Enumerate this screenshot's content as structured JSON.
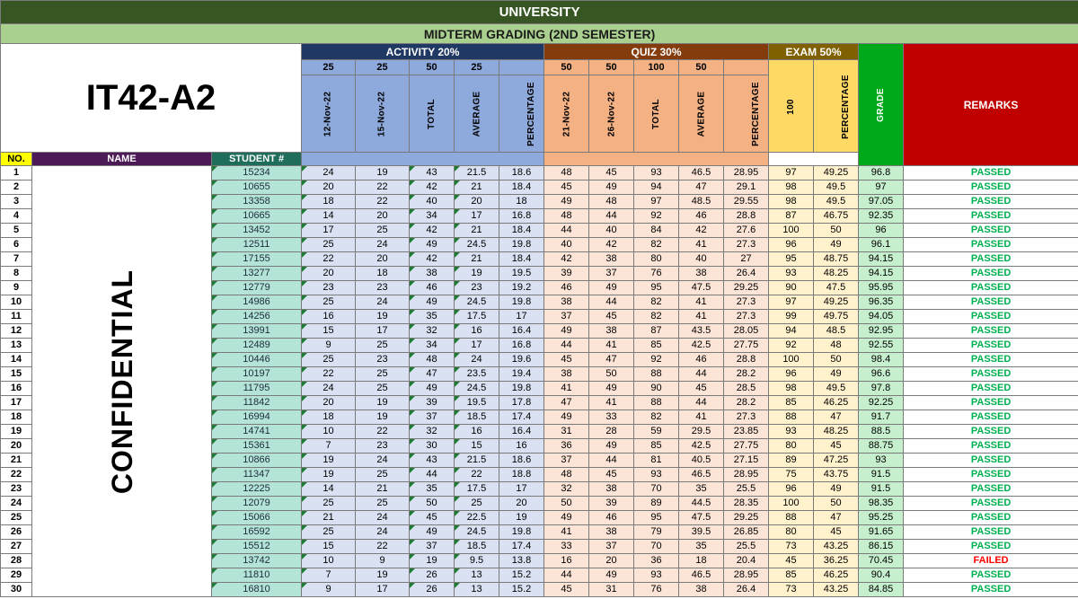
{
  "header": {
    "university": "UNIVERSITY",
    "term": "MIDTERM GRADING (2ND SEMESTER)",
    "section": "IT42-A2",
    "confidential": "CONFIDENTIAL"
  },
  "groups": {
    "activity": "ACTIVITY 20%",
    "quiz": "QUIZ 30%",
    "exam": "EXAM 50%",
    "grade": "GRADE",
    "remarks": "REMARKS"
  },
  "points": {
    "act1": "25",
    "act2": "25",
    "act_total": "50",
    "act_avg": "25",
    "quiz1": "50",
    "quiz2": "50",
    "quiz_total": "100",
    "quiz_avg": "50"
  },
  "sub_headers": {
    "act1": "12-Nov-22",
    "act2": "15-Nov-22",
    "act_total": "TOTAL",
    "act_avg": "AVERAGE",
    "act_pct": "PERCENTAGE",
    "quiz1": "21-Nov-22",
    "quiz2": "26-Nov-22",
    "quiz_total": "TOTAL",
    "quiz_avg": "AVERAGE",
    "quiz_pct": "PERCENTAGE",
    "exam": "100",
    "exam_pct": "PERCENTAGE"
  },
  "columns": {
    "no": "NO.",
    "name": "NAME",
    "student": "STUDENT #"
  },
  "colors": {
    "pass": "#00b050",
    "fail": "#ff0000",
    "university_bg": "#375623",
    "midterm_bg": "#a9d08e",
    "activity": "#203864",
    "quiz": "#843c0c",
    "exam": "#806000",
    "grade": "#00a91a",
    "remarks": "#c00000"
  },
  "rows": [
    {
      "no": "1",
      "sid": "15234",
      "a1": "24",
      "a2": "19",
      "at": "43",
      "aa": "21.5",
      "ap": "18.6",
      "q1": "48",
      "q2": "45",
      "qt": "93",
      "qa": "46.5",
      "qp": "28.95",
      "e": "97",
      "ep": "49.25",
      "g": "96.8",
      "r": "PASSED"
    },
    {
      "no": "2",
      "sid": "10655",
      "a1": "20",
      "a2": "22",
      "at": "42",
      "aa": "21",
      "ap": "18.4",
      "q1": "45",
      "q2": "49",
      "qt": "94",
      "qa": "47",
      "qp": "29.1",
      "e": "98",
      "ep": "49.5",
      "g": "97",
      "r": "PASSED"
    },
    {
      "no": "3",
      "sid": "13358",
      "a1": "18",
      "a2": "22",
      "at": "40",
      "aa": "20",
      "ap": "18",
      "q1": "49",
      "q2": "48",
      "qt": "97",
      "qa": "48.5",
      "qp": "29.55",
      "e": "98",
      "ep": "49.5",
      "g": "97.05",
      "r": "PASSED"
    },
    {
      "no": "4",
      "sid": "10665",
      "a1": "14",
      "a2": "20",
      "at": "34",
      "aa": "17",
      "ap": "16.8",
      "q1": "48",
      "q2": "44",
      "qt": "92",
      "qa": "46",
      "qp": "28.8",
      "e": "87",
      "ep": "46.75",
      "g": "92.35",
      "r": "PASSED"
    },
    {
      "no": "5",
      "sid": "13452",
      "a1": "17",
      "a2": "25",
      "at": "42",
      "aa": "21",
      "ap": "18.4",
      "q1": "44",
      "q2": "40",
      "qt": "84",
      "qa": "42",
      "qp": "27.6",
      "e": "100",
      "ep": "50",
      "g": "96",
      "r": "PASSED"
    },
    {
      "no": "6",
      "sid": "12511",
      "a1": "25",
      "a2": "24",
      "at": "49",
      "aa": "24.5",
      "ap": "19.8",
      "q1": "40",
      "q2": "42",
      "qt": "82",
      "qa": "41",
      "qp": "27.3",
      "e": "96",
      "ep": "49",
      "g": "96.1",
      "r": "PASSED"
    },
    {
      "no": "7",
      "sid": "17155",
      "a1": "22",
      "a2": "20",
      "at": "42",
      "aa": "21",
      "ap": "18.4",
      "q1": "42",
      "q2": "38",
      "qt": "80",
      "qa": "40",
      "qp": "27",
      "e": "95",
      "ep": "48.75",
      "g": "94.15",
      "r": "PASSED"
    },
    {
      "no": "8",
      "sid": "13277",
      "a1": "20",
      "a2": "18",
      "at": "38",
      "aa": "19",
      "ap": "19.5",
      "q1": "39",
      "q2": "37",
      "qt": "76",
      "qa": "38",
      "qp": "26.4",
      "e": "93",
      "ep": "48.25",
      "g": "94.15",
      "r": "PASSED"
    },
    {
      "no": "9",
      "sid": "12779",
      "a1": "23",
      "a2": "23",
      "at": "46",
      "aa": "23",
      "ap": "19.2",
      "q1": "46",
      "q2": "49",
      "qt": "95",
      "qa": "47.5",
      "qp": "29.25",
      "e": "90",
      "ep": "47.5",
      "g": "95.95",
      "r": "PASSED"
    },
    {
      "no": "10",
      "sid": "14986",
      "a1": "25",
      "a2": "24",
      "at": "49",
      "aa": "24.5",
      "ap": "19.8",
      "q1": "38",
      "q2": "44",
      "qt": "82",
      "qa": "41",
      "qp": "27.3",
      "e": "97",
      "ep": "49.25",
      "g": "96.35",
      "r": "PASSED"
    },
    {
      "no": "11",
      "sid": "14256",
      "a1": "16",
      "a2": "19",
      "at": "35",
      "aa": "17.5",
      "ap": "17",
      "q1": "37",
      "q2": "45",
      "qt": "82",
      "qa": "41",
      "qp": "27.3",
      "e": "99",
      "ep": "49.75",
      "g": "94.05",
      "r": "PASSED"
    },
    {
      "no": "12",
      "sid": "13991",
      "a1": "15",
      "a2": "17",
      "at": "32",
      "aa": "16",
      "ap": "16.4",
      "q1": "49",
      "q2": "38",
      "qt": "87",
      "qa": "43.5",
      "qp": "28.05",
      "e": "94",
      "ep": "48.5",
      "g": "92.95",
      "r": "PASSED"
    },
    {
      "no": "13",
      "sid": "12489",
      "a1": "9",
      "a2": "25",
      "at": "34",
      "aa": "17",
      "ap": "16.8",
      "q1": "44",
      "q2": "41",
      "qt": "85",
      "qa": "42.5",
      "qp": "27.75",
      "e": "92",
      "ep": "48",
      "g": "92.55",
      "r": "PASSED"
    },
    {
      "no": "14",
      "sid": "10446",
      "a1": "25",
      "a2": "23",
      "at": "48",
      "aa": "24",
      "ap": "19.6",
      "q1": "45",
      "q2": "47",
      "qt": "92",
      "qa": "46",
      "qp": "28.8",
      "e": "100",
      "ep": "50",
      "g": "98.4",
      "r": "PASSED"
    },
    {
      "no": "15",
      "sid": "10197",
      "a1": "22",
      "a2": "25",
      "at": "47",
      "aa": "23.5",
      "ap": "19.4",
      "q1": "38",
      "q2": "50",
      "qt": "88",
      "qa": "44",
      "qp": "28.2",
      "e": "96",
      "ep": "49",
      "g": "96.6",
      "r": "PASSED"
    },
    {
      "no": "16",
      "sid": "11795",
      "a1": "24",
      "a2": "25",
      "at": "49",
      "aa": "24.5",
      "ap": "19.8",
      "q1": "41",
      "q2": "49",
      "qt": "90",
      "qa": "45",
      "qp": "28.5",
      "e": "98",
      "ep": "49.5",
      "g": "97.8",
      "r": "PASSED"
    },
    {
      "no": "17",
      "sid": "11842",
      "a1": "20",
      "a2": "19",
      "at": "39",
      "aa": "19.5",
      "ap": "17.8",
      "q1": "47",
      "q2": "41",
      "qt": "88",
      "qa": "44",
      "qp": "28.2",
      "e": "85",
      "ep": "46.25",
      "g": "92.25",
      "r": "PASSED"
    },
    {
      "no": "18",
      "sid": "16994",
      "a1": "18",
      "a2": "19",
      "at": "37",
      "aa": "18.5",
      "ap": "17.4",
      "q1": "49",
      "q2": "33",
      "qt": "82",
      "qa": "41",
      "qp": "27.3",
      "e": "88",
      "ep": "47",
      "g": "91.7",
      "r": "PASSED"
    },
    {
      "no": "19",
      "sid": "14741",
      "a1": "10",
      "a2": "22",
      "at": "32",
      "aa": "16",
      "ap": "16.4",
      "q1": "31",
      "q2": "28",
      "qt": "59",
      "qa": "29.5",
      "qp": "23.85",
      "e": "93",
      "ep": "48.25",
      "g": "88.5",
      "r": "PASSED"
    },
    {
      "no": "20",
      "sid": "15361",
      "a1": "7",
      "a2": "23",
      "at": "30",
      "aa": "15",
      "ap": "16",
      "q1": "36",
      "q2": "49",
      "qt": "85",
      "qa": "42.5",
      "qp": "27.75",
      "e": "80",
      "ep": "45",
      "g": "88.75",
      "r": "PASSED"
    },
    {
      "no": "21",
      "sid": "10866",
      "a1": "19",
      "a2": "24",
      "at": "43",
      "aa": "21.5",
      "ap": "18.6",
      "q1": "37",
      "q2": "44",
      "qt": "81",
      "qa": "40.5",
      "qp": "27.15",
      "e": "89",
      "ep": "47.25",
      "g": "93",
      "r": "PASSED"
    },
    {
      "no": "22",
      "sid": "11347",
      "a1": "19",
      "a2": "25",
      "at": "44",
      "aa": "22",
      "ap": "18.8",
      "q1": "48",
      "q2": "45",
      "qt": "93",
      "qa": "46.5",
      "qp": "28.95",
      "e": "75",
      "ep": "43.75",
      "g": "91.5",
      "r": "PASSED"
    },
    {
      "no": "23",
      "sid": "12225",
      "a1": "14",
      "a2": "21",
      "at": "35",
      "aa": "17.5",
      "ap": "17",
      "q1": "32",
      "q2": "38",
      "qt": "70",
      "qa": "35",
      "qp": "25.5",
      "e": "96",
      "ep": "49",
      "g": "91.5",
      "r": "PASSED"
    },
    {
      "no": "24",
      "sid": "12079",
      "a1": "25",
      "a2": "25",
      "at": "50",
      "aa": "25",
      "ap": "20",
      "q1": "50",
      "q2": "39",
      "qt": "89",
      "qa": "44.5",
      "qp": "28.35",
      "e": "100",
      "ep": "50",
      "g": "98.35",
      "r": "PASSED"
    },
    {
      "no": "25",
      "sid": "15066",
      "a1": "21",
      "a2": "24",
      "at": "45",
      "aa": "22.5",
      "ap": "19",
      "q1": "49",
      "q2": "46",
      "qt": "95",
      "qa": "47.5",
      "qp": "29.25",
      "e": "88",
      "ep": "47",
      "g": "95.25",
      "r": "PASSED"
    },
    {
      "no": "26",
      "sid": "16592",
      "a1": "25",
      "a2": "24",
      "at": "49",
      "aa": "24.5",
      "ap": "19.8",
      "q1": "41",
      "q2": "38",
      "qt": "79",
      "qa": "39.5",
      "qp": "26.85",
      "e": "80",
      "ep": "45",
      "g": "91.65",
      "r": "PASSED"
    },
    {
      "no": "27",
      "sid": "15512",
      "a1": "15",
      "a2": "22",
      "at": "37",
      "aa": "18.5",
      "ap": "17.4",
      "q1": "33",
      "q2": "37",
      "qt": "70",
      "qa": "35",
      "qp": "25.5",
      "e": "73",
      "ep": "43.25",
      "g": "86.15",
      "r": "PASSED"
    },
    {
      "no": "28",
      "sid": "13742",
      "a1": "10",
      "a2": "9",
      "at": "19",
      "aa": "9.5",
      "ap": "13.8",
      "q1": "16",
      "q2": "20",
      "qt": "36",
      "qa": "18",
      "qp": "20.4",
      "e": "45",
      "ep": "36.25",
      "g": "70.45",
      "r": "FAILED"
    },
    {
      "no": "29",
      "sid": "11810",
      "a1": "7",
      "a2": "19",
      "at": "26",
      "aa": "13",
      "ap": "15.2",
      "q1": "44",
      "q2": "49",
      "qt": "93",
      "qa": "46.5",
      "qp": "28.95",
      "e": "85",
      "ep": "46.25",
      "g": "90.4",
      "r": "PASSED"
    },
    {
      "no": "30",
      "sid": "16810",
      "a1": "9",
      "a2": "17",
      "at": "26",
      "aa": "13",
      "ap": "15.2",
      "q1": "45",
      "q2": "31",
      "qt": "76",
      "qa": "38",
      "qp": "26.4",
      "e": "73",
      "ep": "43.25",
      "g": "84.85",
      "r": "PASSED"
    }
  ]
}
